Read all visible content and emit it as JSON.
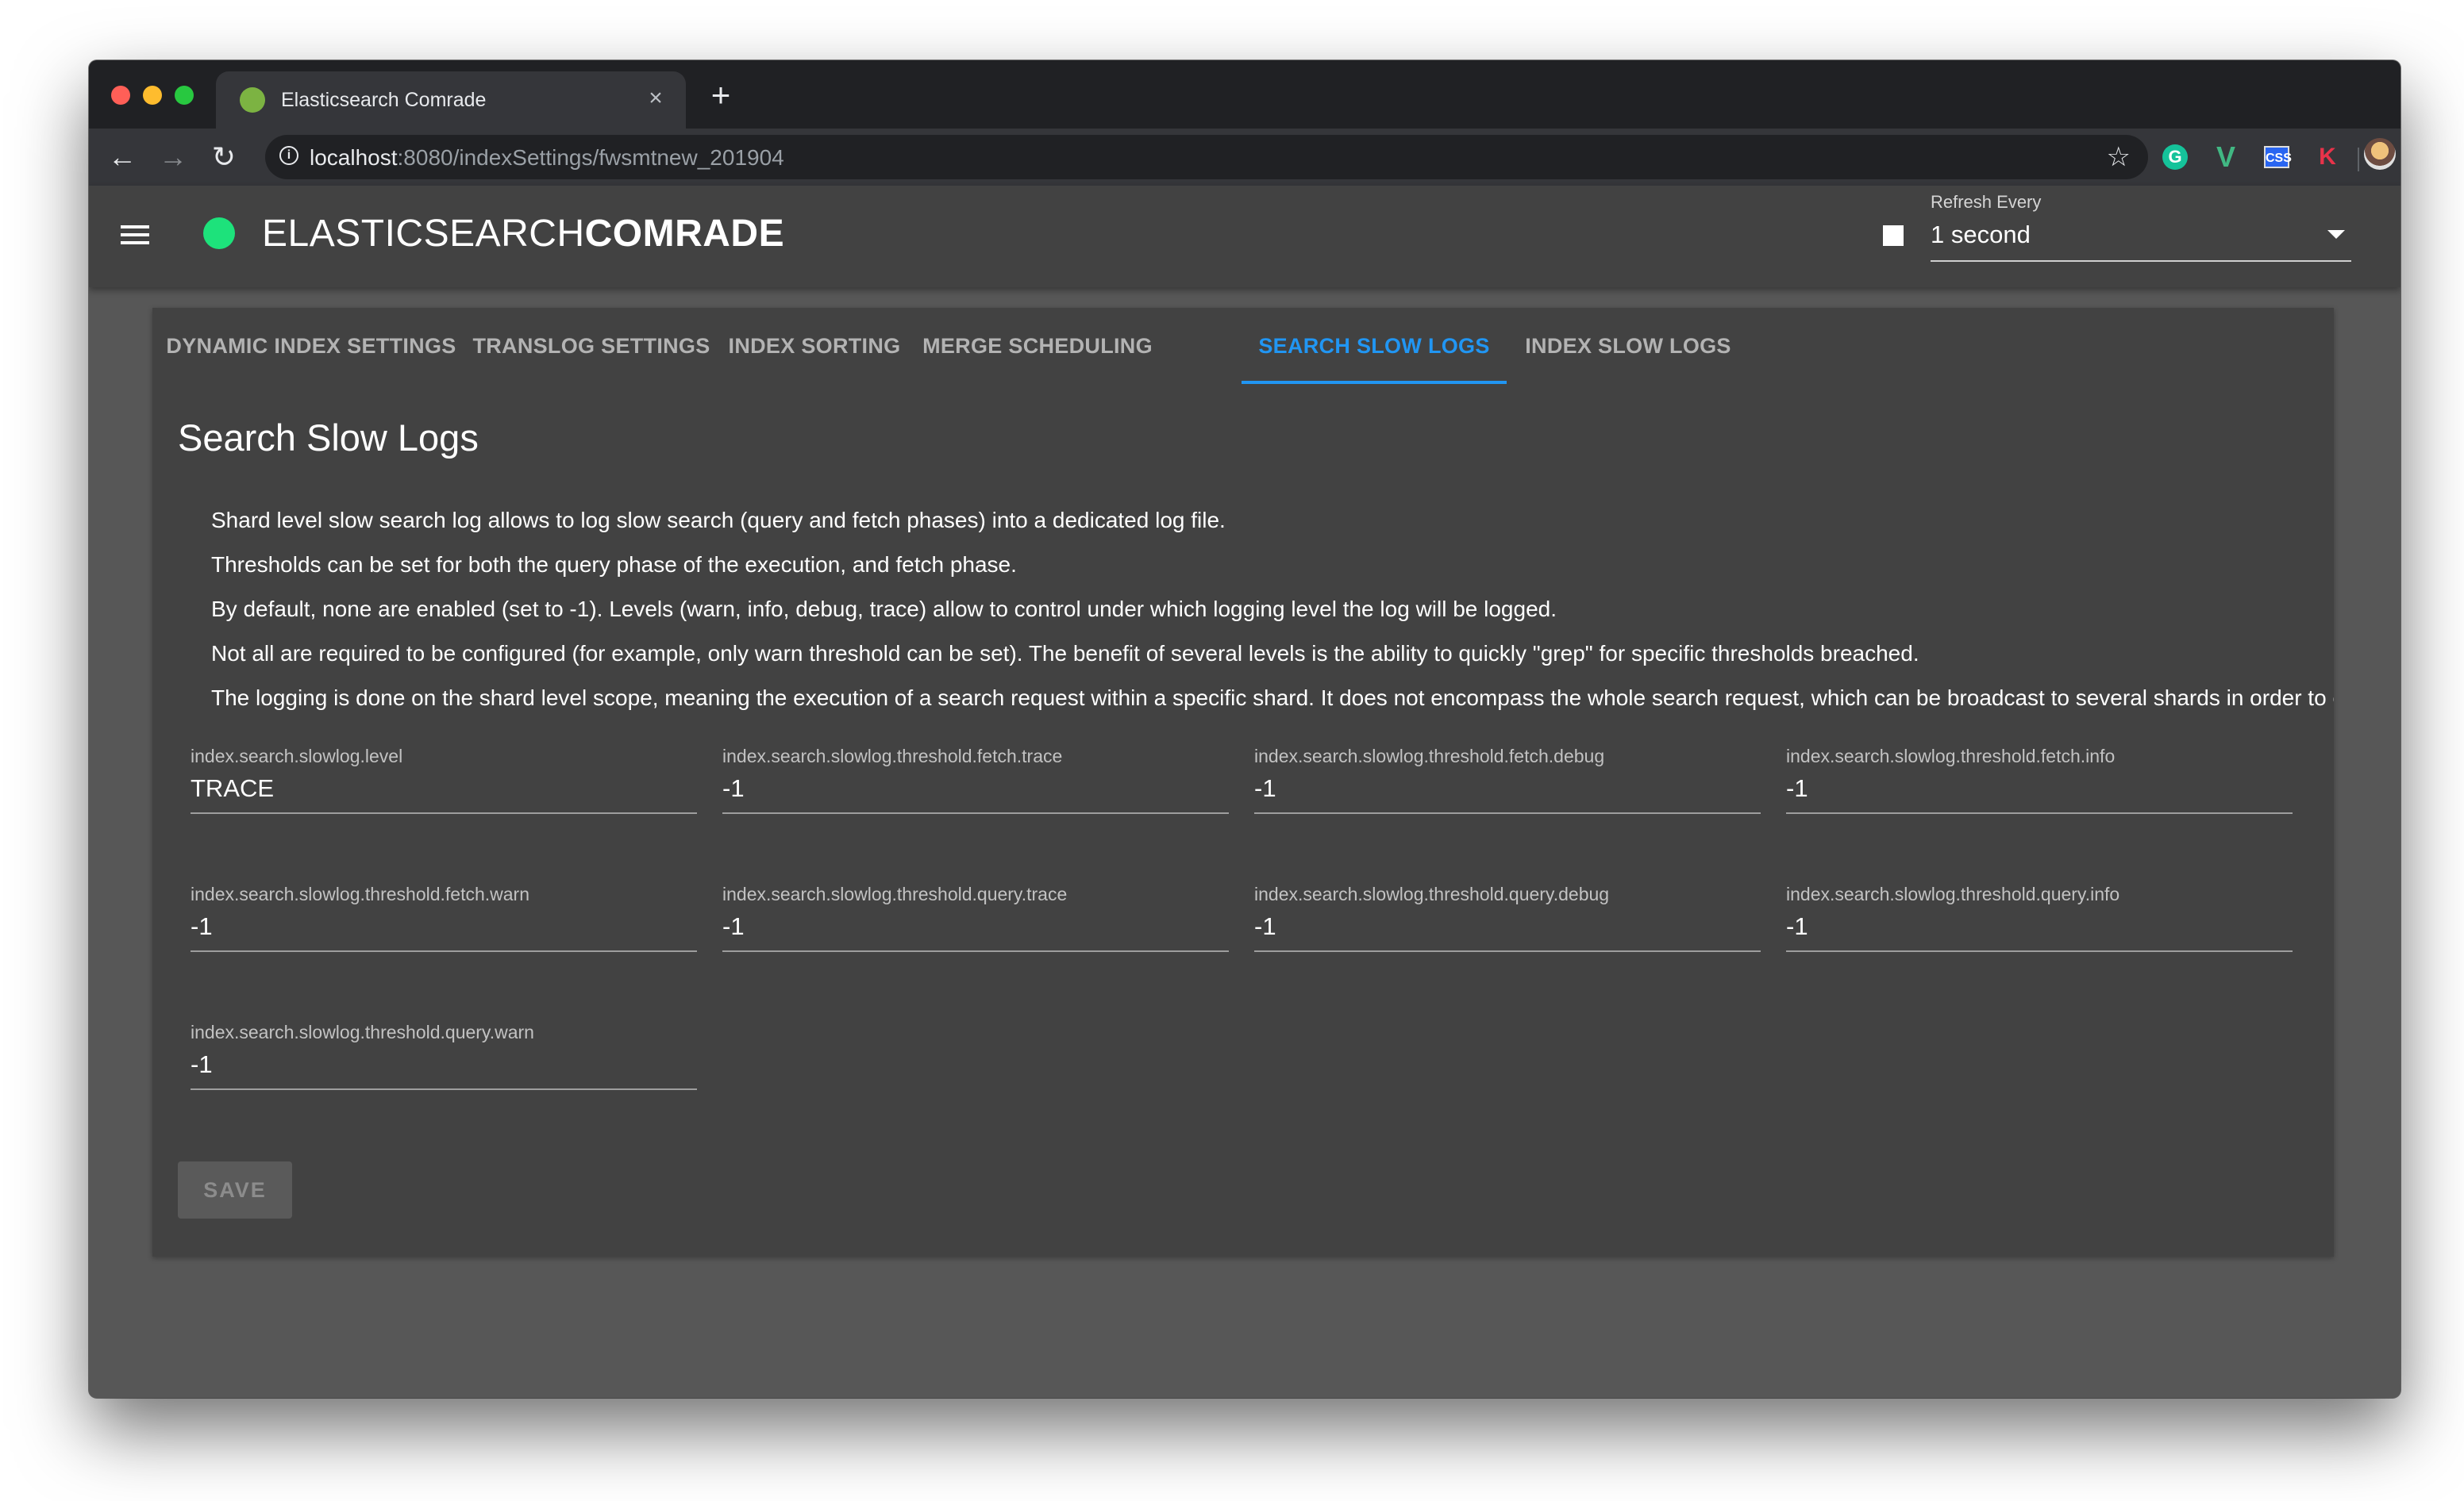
{
  "browser": {
    "tab_title": "Elasticsearch Comrade",
    "tab_close": "×",
    "new_tab": "+",
    "url_host": "localhost",
    "url_rest": ":8080/indexSettings/fwsmtnew_201904",
    "extensions": [
      "grammarly-icon",
      "vue-devtools-icon",
      "css-viewer-icon",
      "k-extension-icon"
    ]
  },
  "app": {
    "brand_light": "ELASTICSEARCH",
    "brand_bold": "COMRADE",
    "status_color": "#1de27b",
    "refresh_label": "Refresh Every",
    "refresh_value": "1 second"
  },
  "tabs": [
    {
      "label": "DYNAMIC INDEX SETTINGS",
      "active": false
    },
    {
      "label": "TRANSLOG SETTINGS",
      "active": false
    },
    {
      "label": "INDEX SORTING",
      "active": false
    },
    {
      "label": "MERGE SCHEDULING",
      "active": false
    },
    {
      "label": "SEARCH SLOW LOGS",
      "active": true
    },
    {
      "label": "INDEX SLOW LOGS",
      "active": false
    }
  ],
  "section": {
    "title": "Search Slow Logs",
    "description": [
      "Shard level slow search log allows to log slow search (query and fetch phases) into a dedicated log file.",
      "Thresholds can be set for both the query phase of the execution, and fetch phase.",
      "By default, none are enabled (set to -1). Levels (warn, info, debug, trace) allow to control under which logging level the log will be logged.",
      "Not all are required to be configured (for example, only warn threshold can be set). The benefit of several levels is the ability to quickly \"grep\" for specific thresholds breached.",
      "The logging is done on the shard level scope, meaning the execution of a search request within a specific shard. It does not encompass the whole search request, which can be broadcast to several shards in order to execu"
    ]
  },
  "fields": [
    {
      "label": "index.search.slowlog.level",
      "value": "TRACE"
    },
    {
      "label": "index.search.slowlog.threshold.fetch.trace",
      "value": "-1"
    },
    {
      "label": "index.search.slowlog.threshold.fetch.debug",
      "value": "-1"
    },
    {
      "label": "index.search.slowlog.threshold.fetch.info",
      "value": "-1"
    },
    {
      "label": "index.search.slowlog.threshold.fetch.warn",
      "value": "-1"
    },
    {
      "label": "index.search.slowlog.threshold.query.trace",
      "value": "-1"
    },
    {
      "label": "index.search.slowlog.threshold.query.debug",
      "value": "-1"
    },
    {
      "label": "index.search.slowlog.threshold.query.info",
      "value": "-1"
    },
    {
      "label": "index.search.slowlog.threshold.query.warn",
      "value": "-1"
    }
  ],
  "actions": {
    "save_label": "SAVE"
  },
  "colors": {
    "accent": "#2196f3",
    "app_background": "#575757",
    "card_background": "#424242"
  }
}
